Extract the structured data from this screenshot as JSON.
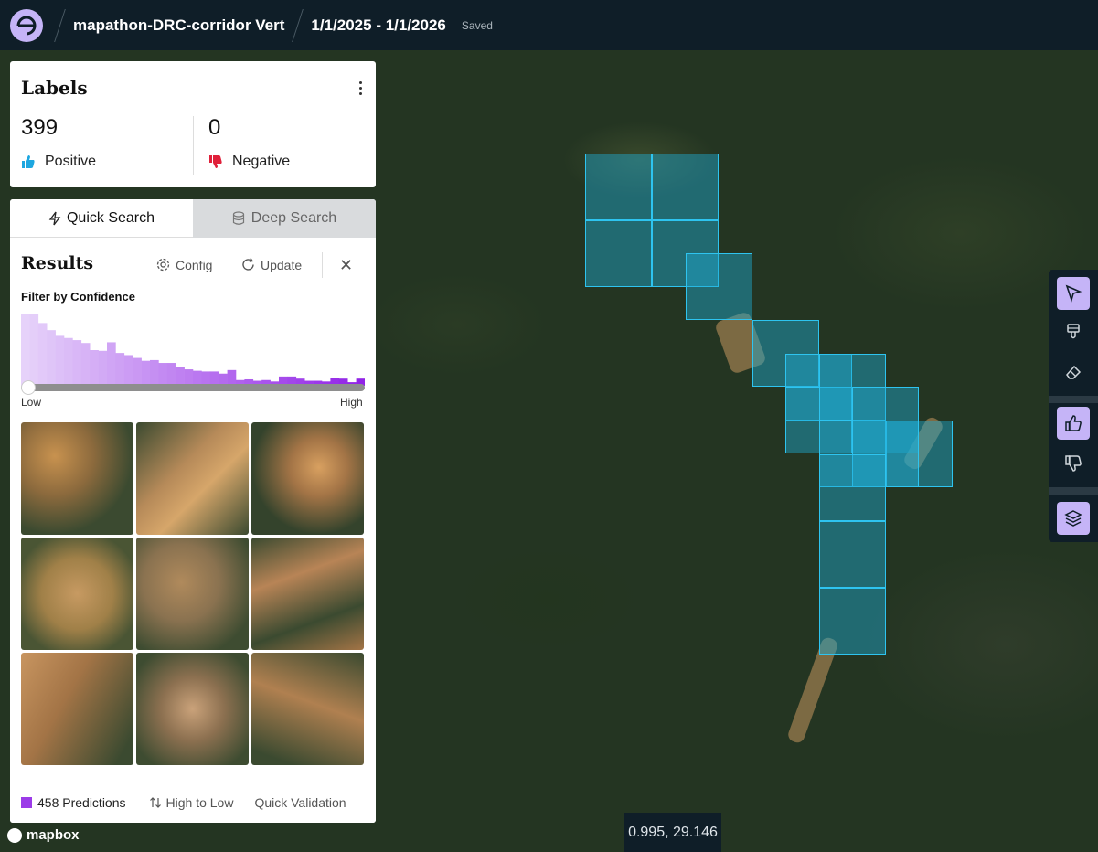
{
  "header": {
    "project_name": "mapathon-DRC-corridor Vert",
    "date_range": "1/1/2025 - 1/1/2026",
    "status": "Saved"
  },
  "labels": {
    "title": "Labels",
    "positive_count": "399",
    "positive_label": "Positive",
    "negative_count": "0",
    "negative_label": "Negative"
  },
  "search_tabs": [
    {
      "label": "Quick Search",
      "active": true
    },
    {
      "label": "Deep Search",
      "active": false
    }
  ],
  "results": {
    "title": "Results",
    "config_label": "Config",
    "update_label": "Update",
    "filter_label": "Filter by Confidence",
    "low_label": "Low",
    "high_label": "High",
    "histogram_bins": [
      100,
      100,
      88,
      78,
      70,
      67,
      64,
      60,
      50,
      49,
      61,
      46,
      43,
      39,
      35,
      36,
      32,
      32,
      26,
      23,
      21,
      20,
      20,
      17,
      22,
      8,
      9,
      7,
      8,
      6,
      13,
      13,
      10,
      7,
      7,
      6,
      11,
      10,
      5,
      10
    ],
    "predictions_label": "458 Predictions",
    "sort_label": "High to Low",
    "validation_label": "Quick Validation"
  },
  "toolbar": {
    "tools": [
      "select-icon",
      "brush-icon",
      "eraser-icon",
      "thumbs-up-icon",
      "thumbs-down-icon",
      "layers-icon"
    ]
  },
  "map": {
    "coordinates": "0.995, 29.146",
    "attribution": "mapbox"
  },
  "colors": {
    "accent": "#c5b4f7",
    "tile_fill": "#1eaad2",
    "tile_border": "#2ec4f0",
    "positive": "#1ea7e0",
    "negative": "#e0203a",
    "prediction": "#9b3be8"
  }
}
